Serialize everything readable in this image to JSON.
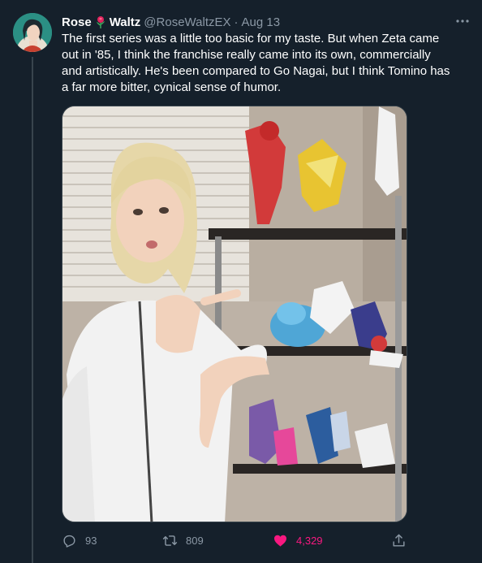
{
  "tweet": {
    "display_name_1": "Rose",
    "display_name_2": "Waltz",
    "handle": "@RoseWaltzEX",
    "separator": "·",
    "date": "Aug 13",
    "text": "The first series was a little too basic for my taste. But when Zeta came out in '85, I think the franchise really came into its own, commercially and artistically. He's been compared to Go Nagai, but I think Tomino has a far more bitter, cynical sense of humor."
  },
  "icons": {
    "avatar": "avatar",
    "name_emoji": "rose-emoji",
    "more": "more-icon",
    "reply": "reply-icon",
    "retweet": "retweet-icon",
    "like": "heart-filled-icon",
    "share": "share-icon"
  },
  "stats": {
    "replies": "93",
    "retweets": "809",
    "likes": "4,329"
  },
  "colors": {
    "background": "#15202b",
    "text": "#ffffff",
    "secondary": "#8b98a5",
    "like": "#f91880",
    "border": "#38444d"
  },
  "media": {
    "alt": "photo"
  }
}
